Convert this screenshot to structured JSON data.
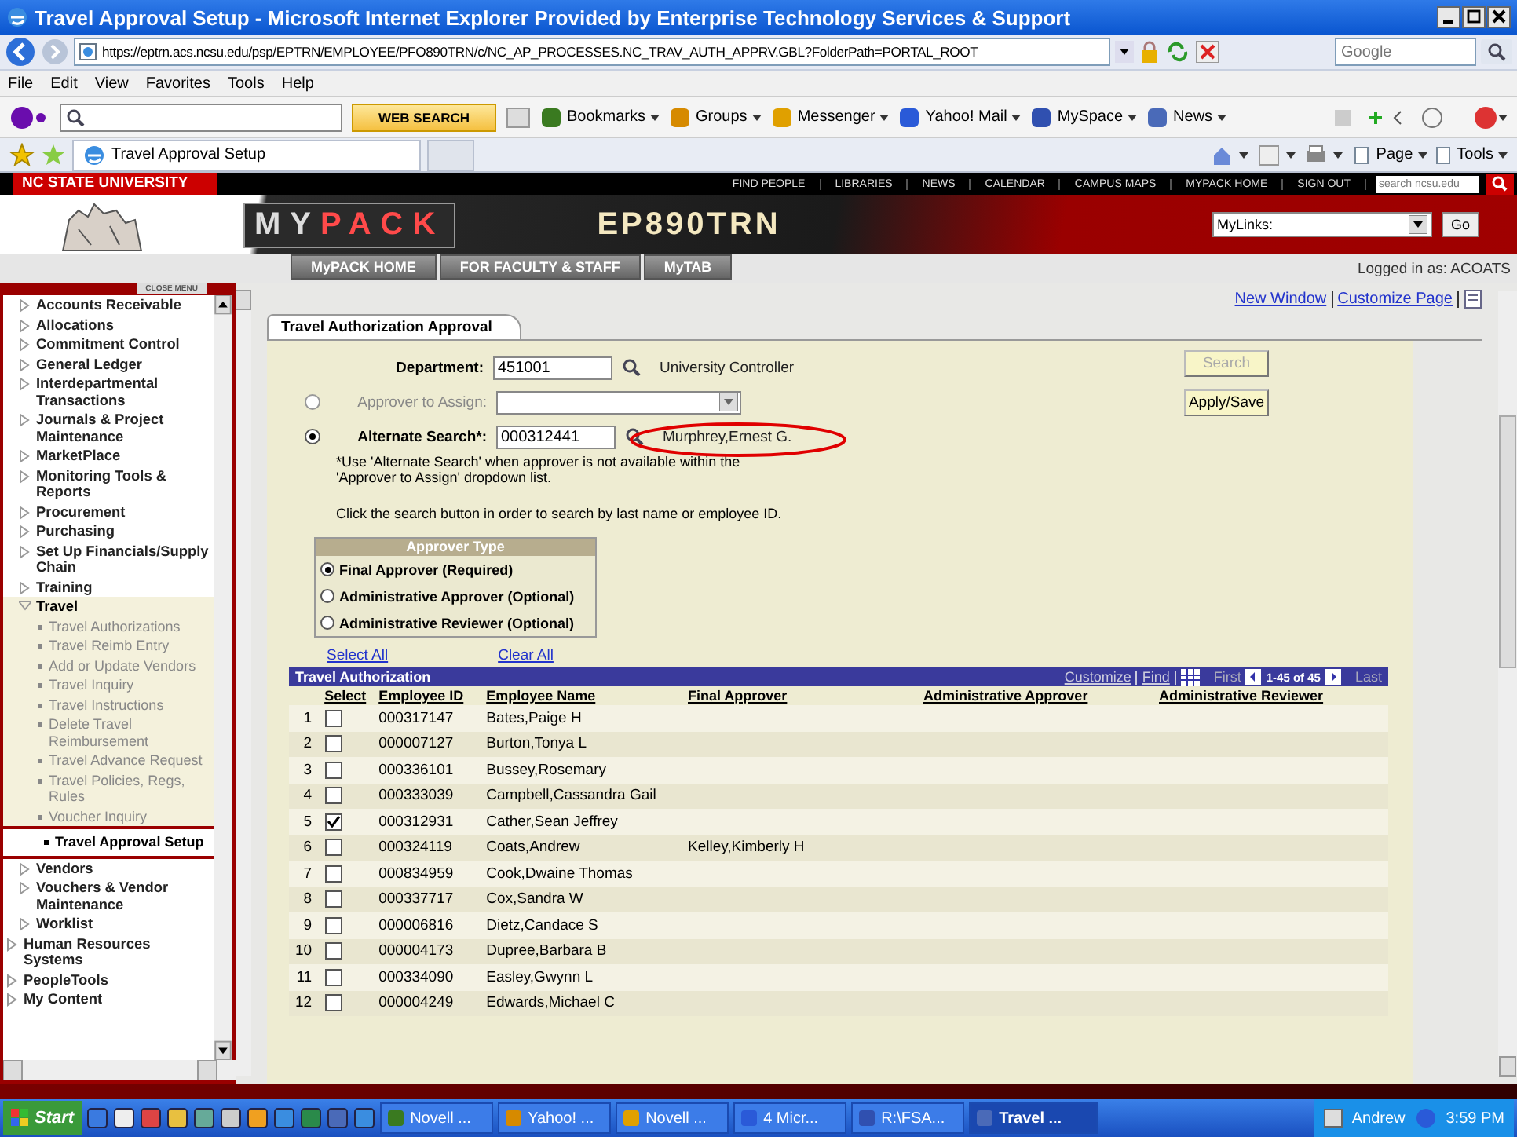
{
  "window": {
    "title": "Travel Approval Setup - Microsoft Internet Explorer Provided by Enterprise Technology Services & Support"
  },
  "address_bar": {
    "url": "https://eptrn.acs.ncsu.edu/psp/EPTRN/EMPLOYEE/PFO890TRN/c/NC_AP_PROCESSES.NC_TRAV_AUTH_APPRV.GBL?FolderPath=PORTAL_ROOT",
    "search_placeholder": "Google"
  },
  "menu_bar": [
    "File",
    "Edit",
    "View",
    "Favorites",
    "Tools",
    "Help"
  ],
  "yahoo_toolbar": {
    "search_button": "WEB SEARCH",
    "items": [
      "Bookmarks",
      "Groups",
      "Messenger",
      "Yahoo! Mail",
      "MySpace",
      "News"
    ]
  },
  "browser_tabs": [
    {
      "label": "Travel Approval Setup",
      "selected": true
    }
  ],
  "command_bar": [
    "Page",
    "Tools"
  ],
  "site_header": {
    "university": "NC STATE UNIVERSITY",
    "links": [
      "FIND PEOPLE",
      "LIBRARIES",
      "NEWS",
      "CALENDAR",
      "CAMPUS MAPS",
      "MYPACK HOME",
      "SIGN OUT"
    ],
    "search_placeholder": "search ncsu.edu",
    "logo_prefix": "MY",
    "logo_suffix": "PACK",
    "system": "EP890TRN",
    "mylinks": "MyLinks:",
    "go": "Go"
  },
  "nav_tabs": [
    "MyPACK HOME",
    "FOR FACULTY & STAFF",
    "MyTAB"
  ],
  "logged_in": "Logged in as: ACOATS",
  "page_links": [
    "New Window",
    "Customize Page"
  ],
  "sidebar": {
    "close_menu": "CLOSE MENU",
    "items": [
      {
        "children": [
          {
            "label": "Accounts Receivable",
            "expanded": false
          },
          {
            "label": "Allocations",
            "expanded": false
          },
          {
            "label": "Commitment Control",
            "expanded": false
          },
          {
            "label": "General Ledger",
            "expanded": false
          },
          {
            "label": "Interdepartmental Transactions",
            "expanded": false
          },
          {
            "label": "Journals & Project Maintenance",
            "expanded": false
          },
          {
            "label": "MarketPlace",
            "expanded": false
          },
          {
            "label": "Monitoring Tools & Reports",
            "expanded": false
          },
          {
            "label": "Procurement",
            "expanded": false
          },
          {
            "label": "Purchasing",
            "expanded": false
          },
          {
            "label": "Set Up Financials/Supply Chain",
            "expanded": false
          },
          {
            "label": "Training",
            "expanded": false
          },
          {
            "label": "Travel",
            "expanded": true,
            "children": [
              {
                "label": "Travel Authorizations",
                "selected": false
              },
              {
                "label": "Travel Reimb Entry",
                "selected": false
              },
              {
                "label": "Add or Update Vendors",
                "selected": false
              },
              {
                "label": "Travel Inquiry",
                "selected": false
              },
              {
                "label": "Travel Instructions",
                "selected": false
              },
              {
                "label": "Delete Travel Reimbursement",
                "selected": false
              },
              {
                "label": "Travel Advance Request",
                "selected": false
              },
              {
                "label": "Travel Policies, Regs, Rules",
                "selected": false
              },
              {
                "label": "Voucher Inquiry",
                "selected": false
              },
              {
                "label": "Travel Approval Setup",
                "selected": true
              }
            ]
          },
          {
            "label": "Vendors",
            "expanded": false
          },
          {
            "label": "Vouchers & Vendor Maintenance",
            "expanded": false
          },
          {
            "label": "Worklist",
            "expanded": false
          }
        ]
      },
      {
        "label": "Human Resources Systems",
        "expanded": false
      },
      {
        "label": "PeopleTools",
        "expanded": false
      },
      {
        "label": "My Content",
        "expanded": false
      }
    ]
  },
  "form": {
    "tab": "Travel Authorization Approval",
    "department": {
      "label": "Department:",
      "value": "451001",
      "description": "University Controller"
    },
    "search_button": {
      "label": "Search",
      "disabled": true
    },
    "apply_button": {
      "label": "Apply/Save",
      "disabled": false
    },
    "approver_option": {
      "label": "Approver to Assign:",
      "selected": false,
      "disabled": true
    },
    "alternate_option": {
      "label": "Alternate Search*:",
      "selected": true,
      "disabled": false,
      "value": "000312441",
      "name": "Murphrey,Ernest G.",
      "highlighted": true
    },
    "note": "*Use 'Alternate Search' when approver is not available within the 'Approver to Assign' dropdown list.",
    "hint": "Click the search button in order to search by last name or employee ID.",
    "approver_type": {
      "title": "Approver Type",
      "options": [
        {
          "label": "Final Approver (Required)",
          "selected": true
        },
        {
          "label": "Administrative Approver (Optional)",
          "selected": false
        },
        {
          "label": "Administrative Reviewer (Optional)",
          "selected": false
        }
      ]
    },
    "select_all": "Select All",
    "clear_all": "Clear All"
  },
  "grid": {
    "title": "Travel Authorization",
    "customize": "Customize",
    "find": "Find",
    "first": "First",
    "range": "1-45 of 45",
    "last": "Last",
    "columns": [
      "Select",
      "Employee ID",
      "Employee Name",
      "Final Approver",
      "Administrative Approver",
      "Administrative Reviewer"
    ],
    "rows": [
      {
        "number": "1",
        "checked": false,
        "employee_id": "000317147",
        "employee_name": "Bates,Paige H"
      },
      {
        "number": "2",
        "checked": false,
        "employee_id": "000007127",
        "employee_name": "Burton,Tonya L"
      },
      {
        "number": "3",
        "checked": false,
        "employee_id": "000336101",
        "employee_name": "Bussey,Rosemary"
      },
      {
        "number": "4",
        "checked": false,
        "employee_id": "000333039",
        "employee_name": "Campbell,Cassandra Gail"
      },
      {
        "number": "5",
        "checked": true,
        "employee_id": "000312931",
        "employee_name": "Cather,Sean Jeffrey"
      },
      {
        "number": "6",
        "checked": false,
        "employee_id": "000324119",
        "employee_name": "Coats,Andrew",
        "final_approver": "Kelley,Kimberly H"
      },
      {
        "number": "7",
        "checked": false,
        "employee_id": "000834959",
        "employee_name": "Cook,Dwaine Thomas"
      },
      {
        "number": "8",
        "checked": false,
        "employee_id": "000337717",
        "employee_name": "Cox,Sandra W"
      },
      {
        "number": "9",
        "checked": false,
        "employee_id": "000006816",
        "employee_name": "Dietz,Candace S"
      },
      {
        "number": "10",
        "checked": false,
        "employee_id": "000004173",
        "employee_name": "Dupree,Barbara B"
      },
      {
        "number": "11",
        "checked": false,
        "employee_id": "000334090",
        "employee_name": "Easley,Gwynn L"
      },
      {
        "number": "12",
        "checked": false,
        "employee_id": "000004249",
        "employee_name": "Edwards,Michael C"
      }
    ]
  },
  "taskbar": {
    "start": "Start",
    "tasks": [
      {
        "label": "Novell ...",
        "selected": false
      },
      {
        "label": "Yahoo! ...",
        "selected": false
      },
      {
        "label": "Novell ...",
        "selected": false
      },
      {
        "label": "4 Micr...",
        "selected": false
      },
      {
        "label": "R:\\FSA...",
        "selected": false
      },
      {
        "label": "Travel ...",
        "selected": true
      }
    ],
    "user": "Andrew",
    "clock": "3:59 PM"
  }
}
